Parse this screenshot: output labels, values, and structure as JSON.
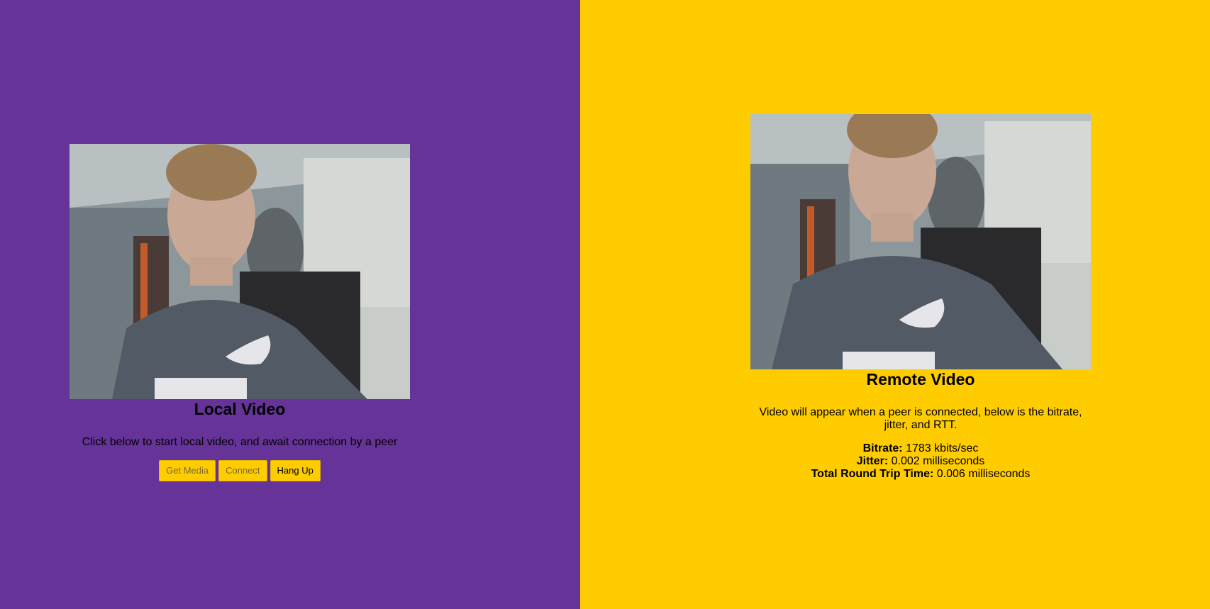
{
  "local": {
    "title": "Local Video",
    "description": "Click below to start local video, and await connection by a peer",
    "buttons": {
      "get_media": "Get Media",
      "connect": "Connect",
      "hang_up": "Hang Up"
    }
  },
  "remote": {
    "title": "Remote Video",
    "description": "Video will appear when a peer is connected, below is the bitrate, jitter, and RTT.",
    "stats": {
      "bitrate_label": "Bitrate:",
      "bitrate_value": "1783 kbits/sec",
      "jitter_label": "Jitter:",
      "jitter_value": "0.002 milliseconds",
      "rtt_label": "Total Round Trip Time:",
      "rtt_value": "0.006 milliseconds"
    }
  },
  "colors": {
    "local_bg": "#663399",
    "remote_bg": "#ffcc00",
    "button_bg": "#ffcc00"
  }
}
